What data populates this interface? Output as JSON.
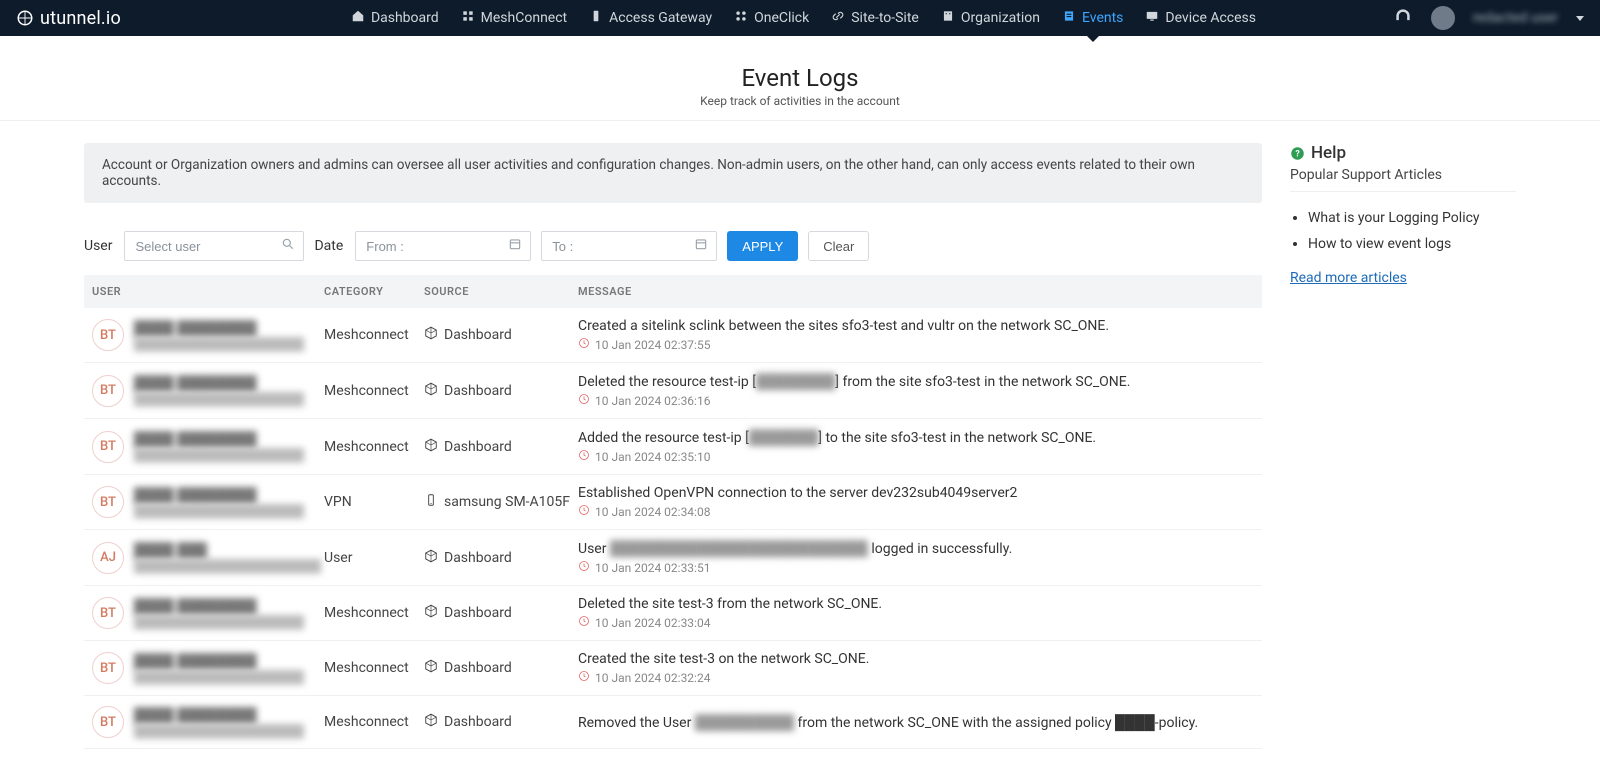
{
  "brand": "utunnel.io",
  "nav": {
    "items": [
      {
        "label": "Dashboard",
        "icon": "home"
      },
      {
        "label": "MeshConnect",
        "icon": "mesh"
      },
      {
        "label": "Access Gateway",
        "icon": "gateway"
      },
      {
        "label": "OneClick",
        "icon": "oneclick"
      },
      {
        "label": "Site-to-Site",
        "icon": "link"
      },
      {
        "label": "Organization",
        "icon": "org"
      },
      {
        "label": "Events",
        "icon": "events",
        "active": true
      },
      {
        "label": "Device Access",
        "icon": "device"
      }
    ],
    "username": "redacted user"
  },
  "page": {
    "title": "Event Logs",
    "subtitle": "Keep track of activities in the account"
  },
  "infobar": "Account or Organization owners and admins can oversee all user activities and configuration changes. Non-admin users, on the other hand, can only access events related to their own accounts.",
  "filters": {
    "user_label": "User",
    "user_placeholder": "Select user",
    "date_label": "Date",
    "from_placeholder": "From :",
    "to_placeholder": "To :",
    "apply": "APPLY",
    "clear": "Clear"
  },
  "table": {
    "headers": {
      "user": "USER",
      "category": "CATEGORY",
      "source": "SOURCE",
      "message": "MESSAGE"
    },
    "rows": [
      {
        "initials": "BT",
        "name": "████ ████████",
        "email": "████████████████████",
        "category": "Meshconnect",
        "source": "Dashboard",
        "source_icon": "cube",
        "message_pre": "Created a sitelink sclink between the sites sfo3-test and vultr on the network SC_ONE.",
        "message_mid_redact": "",
        "message_post": "",
        "ts": "10 Jan 2024 02:37:55"
      },
      {
        "initials": "BT",
        "name": "████ ████████",
        "email": "████████████████████",
        "category": "Meshconnect",
        "source": "Dashboard",
        "source_icon": "cube",
        "message_pre": "Deleted the resource test-ip [",
        "message_mid_redact": "████████",
        "message_post": "] from the site sfo3-test in the network SC_ONE.",
        "ts": "10 Jan 2024 02:36:16"
      },
      {
        "initials": "BT",
        "name": "████ ████████",
        "email": "████████████████████",
        "category": "Meshconnect",
        "source": "Dashboard",
        "source_icon": "cube",
        "message_pre": "Added the resource test-ip [",
        "message_mid_redact": "███████",
        "message_post": "] to the site sfo3-test in the network SC_ONE.",
        "ts": "10 Jan 2024 02:35:10"
      },
      {
        "initials": "BT",
        "name": "████ ████████",
        "email": "████████████████████",
        "category": "VPN",
        "source": "samsung SM-A105F",
        "source_icon": "phone",
        "message_pre": "Established OpenVPN connection to the server dev232sub4049server2",
        "message_mid_redact": "",
        "message_post": "",
        "ts": "10 Jan 2024 02:34:08"
      },
      {
        "initials": "AJ",
        "name": "████ ███",
        "email": "██████████████████████",
        "category": "User",
        "source": "Dashboard",
        "source_icon": "cube",
        "message_pre": "User ",
        "message_mid_redact": "██████████████████████████",
        "message_post": " logged in successfully.",
        "ts": "10 Jan 2024 02:33:51"
      },
      {
        "initials": "BT",
        "name": "████ ████████",
        "email": "████████████████████",
        "category": "Meshconnect",
        "source": "Dashboard",
        "source_icon": "cube",
        "message_pre": "Deleted the site test-3 from the network SC_ONE.",
        "message_mid_redact": "",
        "message_post": "",
        "ts": "10 Jan 2024 02:33:04"
      },
      {
        "initials": "BT",
        "name": "████ ████████",
        "email": "████████████████████",
        "category": "Meshconnect",
        "source": "Dashboard",
        "source_icon": "cube",
        "message_pre": "Created the site test-3 on the network SC_ONE.",
        "message_mid_redact": "",
        "message_post": "",
        "ts": "10 Jan 2024 02:32:24"
      },
      {
        "initials": "BT",
        "name": "████ ████████",
        "email": "████████████████████",
        "category": "Meshconnect",
        "source": "Dashboard",
        "source_icon": "cube",
        "message_pre": "Removed the User ",
        "message_mid_redact": "██████████",
        "message_post": " from the network SC_ONE with the assigned policy ████-policy.",
        "ts": ""
      }
    ]
  },
  "help": {
    "title": "Help",
    "subtitle": "Popular Support Articles",
    "items": [
      "What is your Logging Policy",
      "How to view event logs"
    ],
    "readmore": "Read more articles"
  }
}
